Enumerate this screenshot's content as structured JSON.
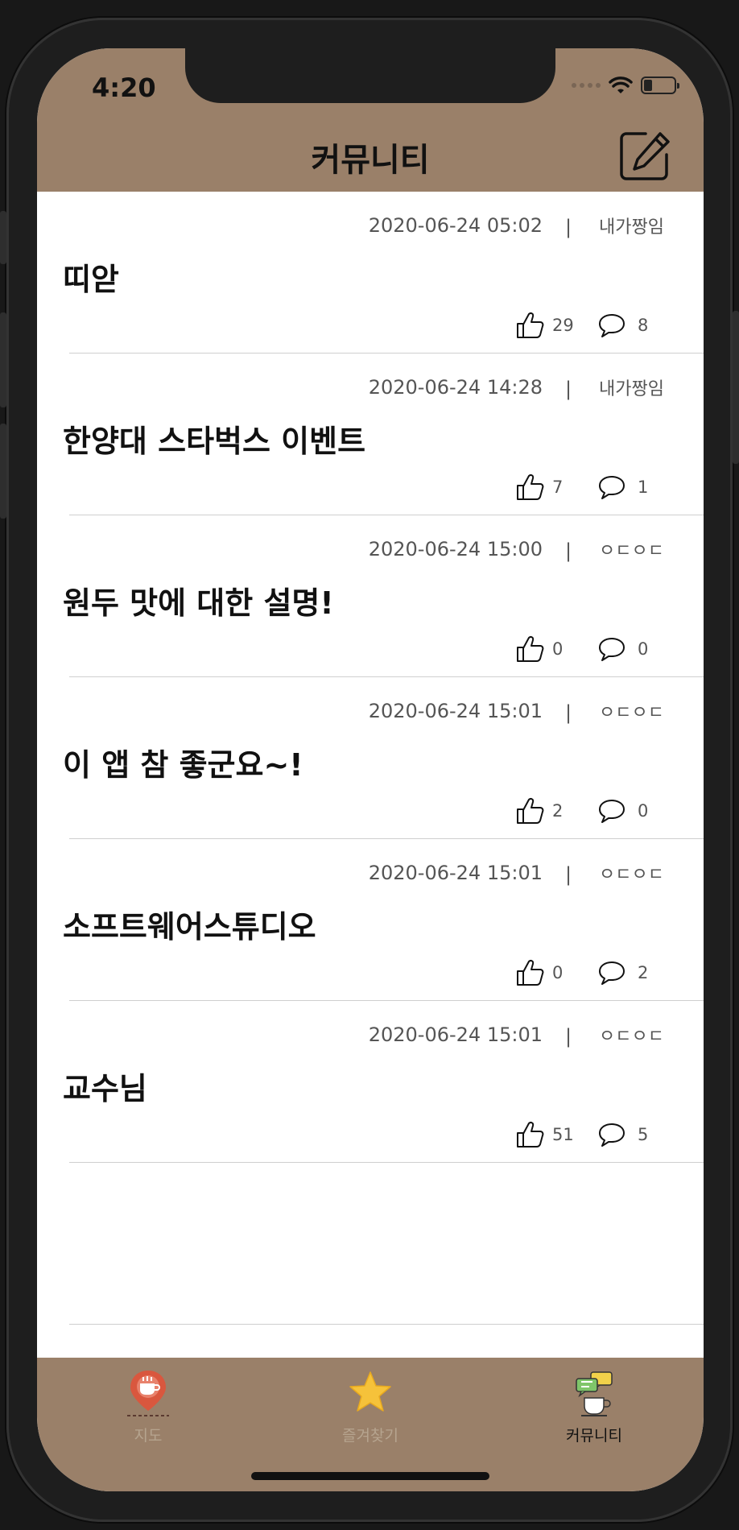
{
  "status_bar": {
    "time": "4:20"
  },
  "header": {
    "title": "커뮤니티",
    "compose_icon": "edit-icon"
  },
  "posts": [
    {
      "date": "2020-06-24 05:02",
      "author": "내가짱임",
      "title": "띠앋",
      "likes": "29",
      "comments": "8"
    },
    {
      "date": "2020-06-24 14:28",
      "author": "내가짱임",
      "title": "한양대 스타벅스 이벤트",
      "likes": "7",
      "comments": "1"
    },
    {
      "date": "2020-06-24 15:00",
      "author": "ㅇㄷㅇㄷ",
      "title": "원두 맛에 대한 설명!",
      "likes": "0",
      "comments": "0"
    },
    {
      "date": "2020-06-24 15:01",
      "author": "ㅇㄷㅇㄷ",
      "title": "이 앱 참 좋군요~!",
      "likes": "2",
      "comments": "0"
    },
    {
      "date": "2020-06-24 15:01",
      "author": "ㅇㄷㅇㄷ",
      "title": "소프트웨어스튜디오",
      "likes": "0",
      "comments": "2"
    },
    {
      "date": "2020-06-24 15:01",
      "author": "ㅇㄷㅇㄷ",
      "title": "교수님",
      "likes": "51",
      "comments": "5"
    }
  ],
  "separator": "|",
  "tabbar": {
    "tabs": [
      {
        "label": "지도",
        "icon": "map-pin-icon",
        "active": false
      },
      {
        "label": "즐겨찾기",
        "icon": "star-icon",
        "active": false
      },
      {
        "label": "커뮤니티",
        "icon": "community-icon",
        "active": true
      }
    ]
  },
  "colors": {
    "brand": "#9a8069",
    "inactive_tab_label": "#b6a48f",
    "active_tab_label": "#111111"
  }
}
